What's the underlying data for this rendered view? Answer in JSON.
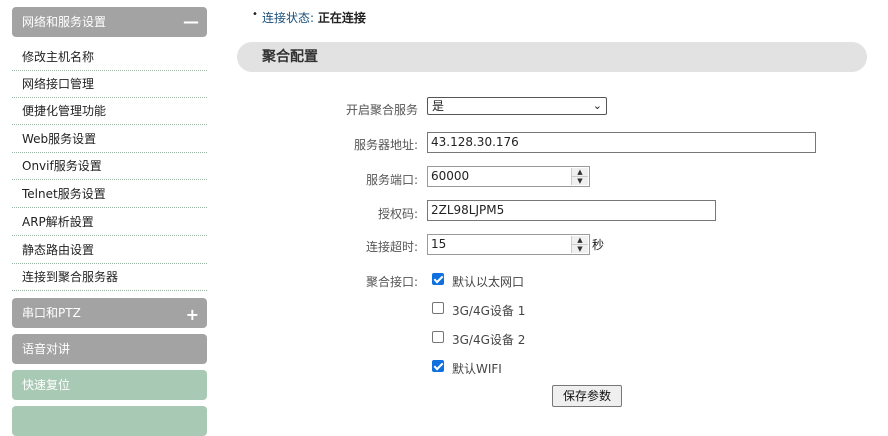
{
  "sidebar": {
    "network_group": {
      "label": "网络和服务设置",
      "toggle": "—"
    },
    "items": [
      {
        "label": "修改主机名称"
      },
      {
        "label": "网络接口管理"
      },
      {
        "label": "便捷化管理功能"
      },
      {
        "label": "Web服务设置"
      },
      {
        "label": "Onvif服务设置"
      },
      {
        "label": "Telnet服务设置"
      },
      {
        "label": "ARP解析設置"
      },
      {
        "label": "静态路由设置"
      },
      {
        "label": "连接到聚合服务器"
      }
    ],
    "serial_group": {
      "label": "串口和PTZ",
      "toggle": "+"
    },
    "voice_group": {
      "label": "语音对讲"
    },
    "reset_group": {
      "label": "快速复位"
    }
  },
  "status": {
    "label": "连接状态:",
    "value": "正在连接"
  },
  "section": {
    "title": "聚合配置"
  },
  "form": {
    "enable": {
      "label": "开启聚合服务",
      "value": "是"
    },
    "server_address": {
      "label": "服务器地址:",
      "value": "43.128.30.176"
    },
    "service_port": {
      "label": "服务端口:",
      "value": "60000"
    },
    "auth_code": {
      "label": "授权码:",
      "value": "2ZL98LJPM5"
    },
    "timeout": {
      "label": "连接超时:",
      "value": "15",
      "unit": "秒"
    },
    "interfaces": {
      "label": "聚合接口:",
      "options": [
        {
          "label": "默认以太网口",
          "checked": true
        },
        {
          "label": "3G/4G设备 1",
          "checked": false
        },
        {
          "label": "3G/4G设备 2",
          "checked": false
        },
        {
          "label": "默认WIFI",
          "checked": true
        }
      ]
    },
    "save_label": "保存参数"
  },
  "colors": {
    "checkbox_accent": "#0f70e0",
    "sidebar_header": "#a3a3a3",
    "sidebar_active": "#a8c9b4"
  }
}
